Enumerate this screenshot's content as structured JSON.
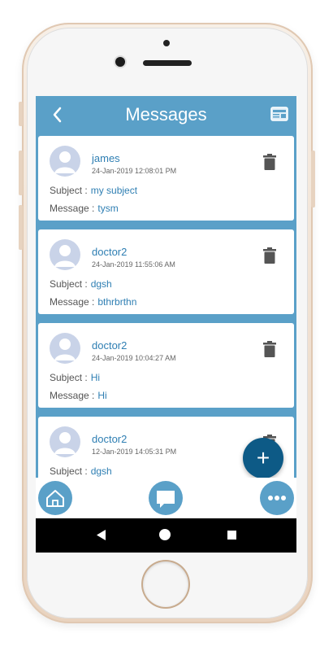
{
  "header": {
    "title": "Messages"
  },
  "messages": [
    {
      "sender": "james",
      "timestamp": "24-Jan-2019 12:08:01 PM",
      "subject_label": "Subject :",
      "subject": "my subject",
      "message_label": "Message :",
      "message": "tysm"
    },
    {
      "sender": "doctor2",
      "timestamp": "24-Jan-2019 11:55:06 AM",
      "subject_label": "Subject :",
      "subject": "dgsh",
      "message_label": "Message :",
      "message": "bthrbrthn"
    },
    {
      "sender": "doctor2",
      "timestamp": "24-Jan-2019 10:04:27 AM",
      "subject_label": "Subject :",
      "subject": "Hi",
      "message_label": "Message :",
      "message": "Hi"
    },
    {
      "sender": "doctor2",
      "timestamp": "12-Jan-2019 14:05:31 PM",
      "subject_label": "Subject :",
      "subject": "dgsh"
    }
  ],
  "fab": {
    "label": "+"
  },
  "icons": {
    "back": "chevron-left-icon",
    "header_action": "id-card-icon",
    "delete": "trash-icon",
    "home": "home-icon",
    "chat": "chat-icon",
    "more": "more-dots-icon"
  },
  "colors": {
    "primary": "#5aa0c8",
    "fab": "#0d5a86",
    "link": "#2f7fb3"
  }
}
